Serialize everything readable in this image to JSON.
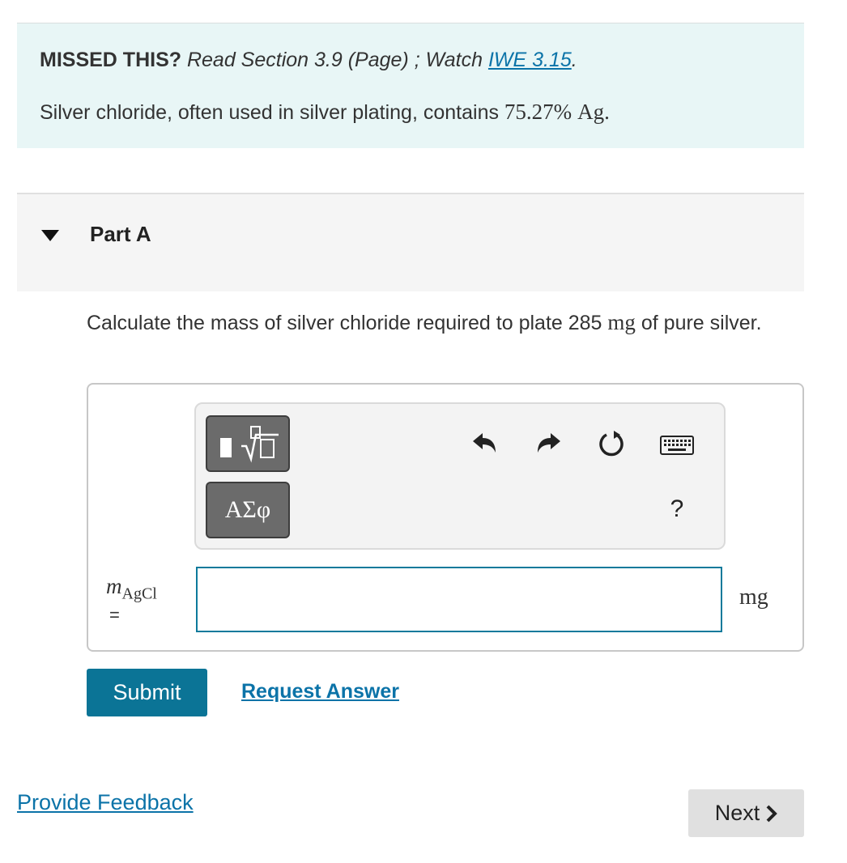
{
  "info_panel": {
    "missed_label": "MISSED THIS?",
    "read_text": "Read Section 3.9 (Page) ; Watch",
    "link_text": "IWE 3.15",
    "link_suffix": ".",
    "statement_prefix": "Silver chloride, often used in silver plating, contains",
    "statement_value": "75.27%",
    "statement_element": "Ag",
    "statement_suffix": "."
  },
  "part": {
    "title": "Part A"
  },
  "question": {
    "text_prefix": "Calculate the mass of silver chloride required to plate 285",
    "unit": "mg",
    "text_suffix": "of pure silver."
  },
  "toolbar": {
    "symbols_label": "ΑΣφ",
    "help_label": "?"
  },
  "answer": {
    "variable": "m",
    "variable_subscript": "AgCl",
    "equals": "=",
    "value": "",
    "unit": "mg"
  },
  "buttons": {
    "submit": "Submit",
    "request_answer": "Request Answer",
    "provide_feedback": "Provide Feedback",
    "next": "Next"
  },
  "icons": {
    "caret": "caret-down-icon",
    "templates": "templates-root-icon",
    "undo": "undo-icon",
    "redo": "redo-icon",
    "reset": "reset-icon",
    "keyboard": "keyboard-icon",
    "next": "chevron-right-icon"
  },
  "colors": {
    "info_background": "#e8f6f6",
    "accent": "#0b7496",
    "link": "#0b73a8"
  }
}
